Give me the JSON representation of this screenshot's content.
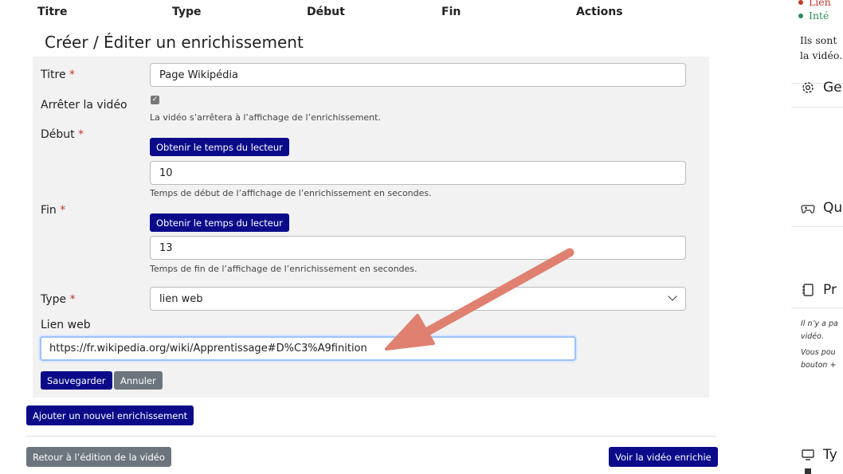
{
  "table_headers": [
    "Titre",
    "Type",
    "Début",
    "Fin",
    "Actions"
  ],
  "form": {
    "heading": "Créer / Éditer un enrichissement",
    "required_mark": "*",
    "titre_label": "Titre",
    "titre_value": "Page Wikipédia",
    "stop_label": "Arrêter la vidéo",
    "stop_help": "La vidéo s’arrêtera à l’affichage de l’enrichissement.",
    "stop_checked": "✓",
    "debut_label": "Début",
    "debut_btn": "Obtenir le temps du lecteur",
    "debut_value": "10",
    "debut_help": "Temps de début de l’affichage de l’enrichissement en secondes.",
    "fin_label": "Fin",
    "fin_btn": "Obtenir le temps du lecteur",
    "fin_value": "13",
    "fin_help": "Temps de fin de l’affichage de l’enrichissement en secondes.",
    "type_label": "Type",
    "type_value": "lien web",
    "weblink_label": "Lien web",
    "weblink_value": "https://fr.wikipedia.org/wiki/Apprentissage#D%C3%A9finition",
    "save_btn": "Sauvegarder",
    "cancel_btn": "Annuler"
  },
  "add_btn": "Ajouter un nouvel enrichissement",
  "back_btn": "Retour à l’édition de la vidéo",
  "view_btn": "Voir la vidéo enrichie",
  "sidebar": {
    "bullet1": "Lien",
    "bullet2": "Inté",
    "para1": "Ils sont",
    "para2": "la vidéo.",
    "sec1": "Ge",
    "sec2": "Qu",
    "sec3": "Pr",
    "note1": "Il n’y a pa",
    "note2": "vidéo.",
    "note3": "Vous pou",
    "note4": "bouton +",
    "sec4": "Ty"
  },
  "colors": {
    "navy": "#0b0b8a",
    "gray": "#6c757d",
    "arrow": "#e08070",
    "red_bullet": "#c0392b",
    "green_bullet": "#2e8b57"
  }
}
